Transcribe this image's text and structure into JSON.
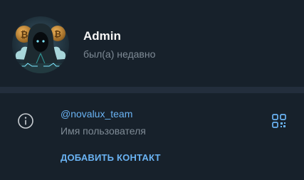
{
  "profile": {
    "name": "Admin",
    "status": "был(а) недавно",
    "avatar_icon": "hooded-figure-bitcoin-avatar"
  },
  "info": {
    "icon": "info-icon",
    "username": "@novalux_team",
    "username_caption": "Имя пользователя",
    "qr_icon": "qr-code-icon",
    "add_contact_label": "ДОБАВИТЬ КОНТАКТ"
  },
  "colors": {
    "background": "#17212b",
    "divider": "#232e3c",
    "accent": "#6ab3f3",
    "secondary_text": "#7f8b96",
    "primary_text": "#f5f5f5"
  }
}
